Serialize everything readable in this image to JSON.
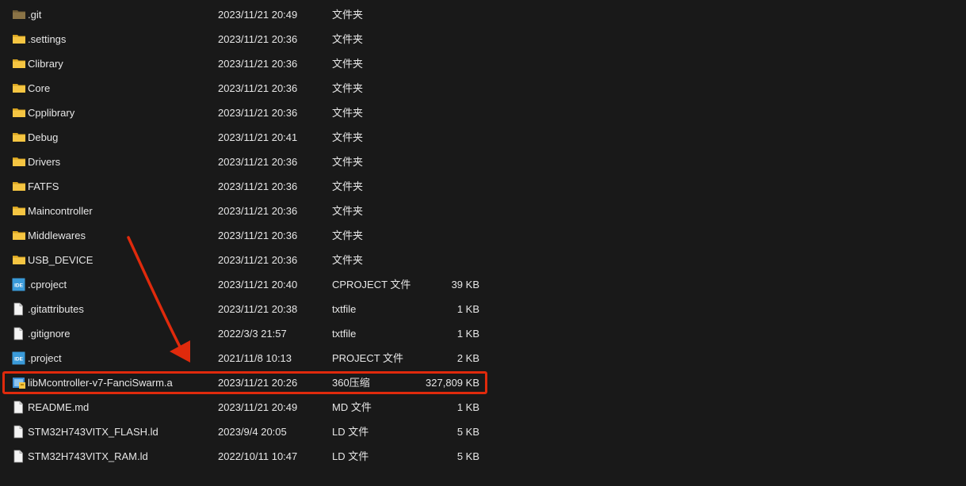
{
  "files": [
    {
      "name": ".git",
      "date": "2023/11/21 20:49",
      "type": "文件夹",
      "size": "",
      "icon": "folder-icon"
    },
    {
      "name": ".settings",
      "date": "2023/11/21 20:36",
      "type": "文件夹",
      "size": "",
      "icon": "folder-icon"
    },
    {
      "name": "Clibrary",
      "date": "2023/11/21 20:36",
      "type": "文件夹",
      "size": "",
      "icon": "folder-icon"
    },
    {
      "name": "Core",
      "date": "2023/11/21 20:36",
      "type": "文件夹",
      "size": "",
      "icon": "folder-icon"
    },
    {
      "name": "Cpplibrary",
      "date": "2023/11/21 20:36",
      "type": "文件夹",
      "size": "",
      "icon": "folder-icon"
    },
    {
      "name": "Debug",
      "date": "2023/11/21 20:41",
      "type": "文件夹",
      "size": "",
      "icon": "folder-icon"
    },
    {
      "name": "Drivers",
      "date": "2023/11/21 20:36",
      "type": "文件夹",
      "size": "",
      "icon": "folder-icon"
    },
    {
      "name": "FATFS",
      "date": "2023/11/21 20:36",
      "type": "文件夹",
      "size": "",
      "icon": "folder-icon"
    },
    {
      "name": "Maincontroller",
      "date": "2023/11/21 20:36",
      "type": "文件夹",
      "size": "",
      "icon": "folder-icon"
    },
    {
      "name": "Middlewares",
      "date": "2023/11/21 20:36",
      "type": "文件夹",
      "size": "",
      "icon": "folder-icon"
    },
    {
      "name": "USB_DEVICE",
      "date": "2023/11/21 20:36",
      "type": "文件夹",
      "size": "",
      "icon": "folder-icon"
    },
    {
      "name": ".cproject",
      "date": "2023/11/21 20:40",
      "type": "CPROJECT 文件",
      "size": "39 KB",
      "icon": "ide-file-icon",
      "icon_text": "IDE"
    },
    {
      "name": ".gitattributes",
      "date": "2023/11/21 20:38",
      "type": "txtfile",
      "size": "1 KB",
      "icon": "document-icon"
    },
    {
      "name": ".gitignore",
      "date": "2022/3/3 21:57",
      "type": "txtfile",
      "size": "1 KB",
      "icon": "document-icon"
    },
    {
      "name": ".project",
      "date": "2021/11/8 10:13",
      "type": "PROJECT 文件",
      "size": "2 KB",
      "icon": "ide-file-icon",
      "icon_text": "IDE"
    },
    {
      "name": "libMcontroller-v7-FanciSwarm.a",
      "date": "2023/11/21 20:26",
      "type": "360压缩",
      "size": "327,809 KB",
      "icon": "archive-icon",
      "highlighted": true
    },
    {
      "name": "README.md",
      "date": "2023/11/21 20:49",
      "type": "MD 文件",
      "size": "1 KB",
      "icon": "document-icon"
    },
    {
      "name": "STM32H743VITX_FLASH.ld",
      "date": "2023/9/4 20:05",
      "type": "LD 文件",
      "size": "5 KB",
      "icon": "document-icon"
    },
    {
      "name": "STM32H743VITX_RAM.ld",
      "date": "2022/10/11 10:47",
      "type": "LD 文件",
      "size": "5 KB",
      "icon": "document-icon"
    }
  ],
  "colors": {
    "background": "#191919",
    "text": "#e6e6e6",
    "folder": "#f5c542",
    "folder_dark": "#d9a521",
    "git_folder": "#8a7346",
    "ide_blue": "#3a9ad9",
    "annotation_red": "#e02a0c"
  }
}
